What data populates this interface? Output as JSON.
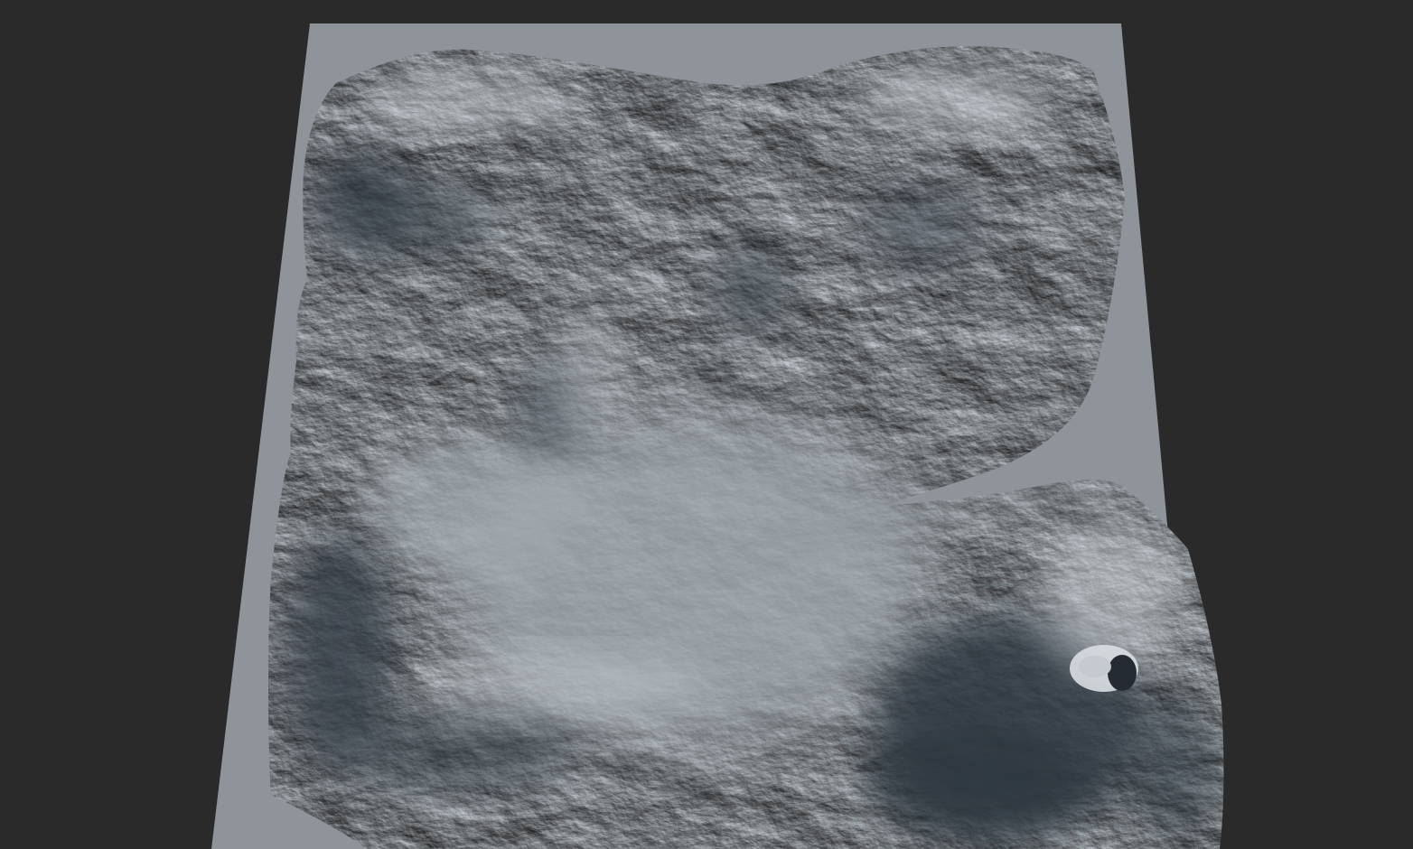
{
  "app": {
    "view": "3d-viewport",
    "background_color": "#2a2a2a"
  },
  "scene": {
    "object": "terrain-heightmap",
    "render_mode": "shaded",
    "ground_plane_color": "#8e949a",
    "terrain_light_color": "#c4cacf",
    "terrain_mid_color": "#9aa1a7",
    "terrain_shadow_color": "#3a434c",
    "features": [
      {
        "name": "northern-ridge",
        "kind": "mountain-range"
      },
      {
        "name": "northeast-massif",
        "kind": "mountain-range"
      },
      {
        "name": "western-ridge",
        "kind": "mountain-range"
      },
      {
        "name": "central-valley",
        "kind": "valley"
      },
      {
        "name": "southern-ridge",
        "kind": "mountain-range"
      },
      {
        "name": "volcano",
        "kind": "volcanic-cone"
      },
      {
        "name": "volcano-crater",
        "kind": "crater"
      }
    ]
  }
}
